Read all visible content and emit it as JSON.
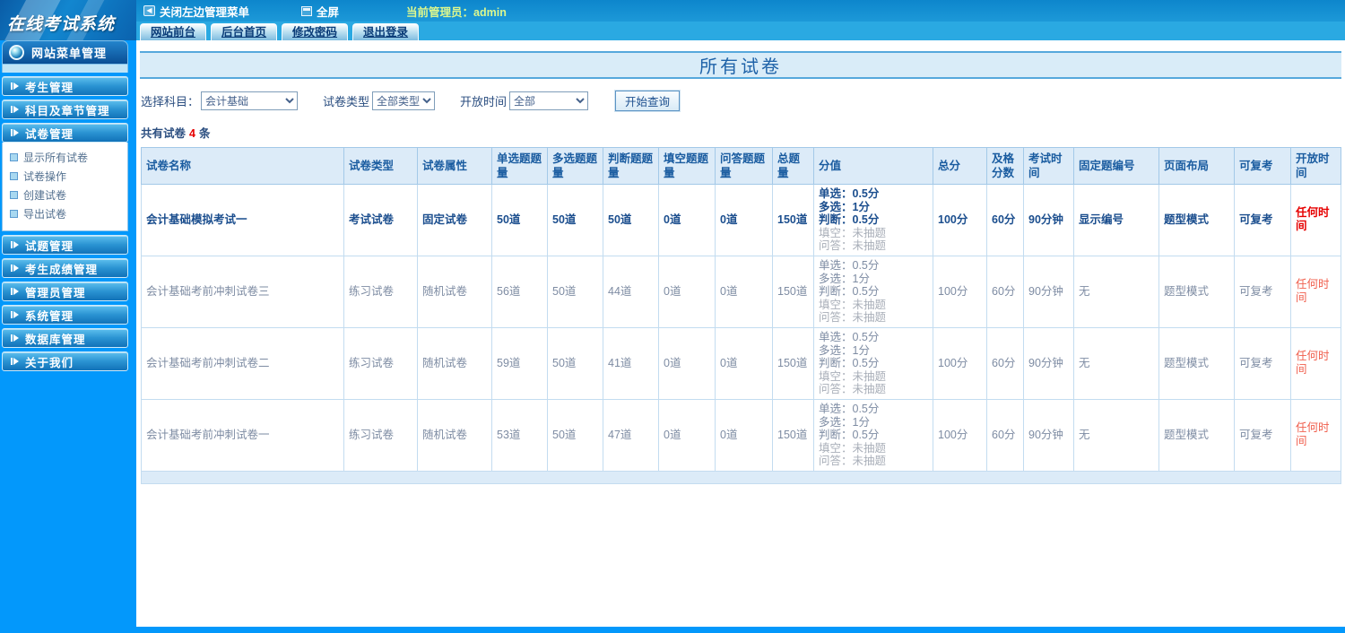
{
  "topbar": {
    "logo": "在线考试系统",
    "close_menu_label": "关闭左边管理菜单",
    "fullscreen_label": "全屏",
    "admin_label": "当前管理员：admin",
    "tabs": [
      "网站前台",
      "后台首页",
      "修改密码",
      "退出登录"
    ]
  },
  "sidebar": {
    "header": "网站菜单管理",
    "items": [
      "考生管理",
      "科目及章节管理",
      "试卷管理",
      "试题管理",
      "考生成绩管理",
      "管理员管理",
      "系统管理",
      "数据库管理",
      "关于我们"
    ],
    "submenu": [
      "显示所有试卷",
      "试卷操作",
      "创建试卷",
      "导出试卷"
    ]
  },
  "main": {
    "title": "所有试卷",
    "filters": {
      "subject_label": "选择科目：",
      "subject_value": "会计基础",
      "type_label": "试卷类型",
      "type_value": "全部类型",
      "open_label": "开放时间",
      "open_value": "全部",
      "query_button": "开始查询"
    },
    "count": {
      "prefix": "共有试卷",
      "value": "4",
      "suffix": "条"
    }
  },
  "table": {
    "columns": [
      "试卷名称",
      "试卷类型",
      "试卷属性",
      "单选题题量",
      "多选题题量",
      "判断题题量",
      "填空题题量",
      "问答题题量",
      "总题量",
      "分值",
      "总分",
      "及格分数",
      "考试时间",
      "固定题编号",
      "页面布局",
      "可复考",
      "开放时间"
    ],
    "rows": [
      {
        "name": "会计基础模拟考试一",
        "type": "考试试卷",
        "attr": "固定试卷",
        "single": "50道",
        "multi": "50道",
        "judge": "50道",
        "blank": "0道",
        "qa": "0道",
        "total": "150道",
        "scores": [
          "单选：0.5分",
          "多选：1分",
          "判断：0.5分",
          "填空：未抽题",
          "问答：未抽题"
        ],
        "total_score": "100分",
        "pass_score": "60分",
        "exam_time": "90分钟",
        "fixed_no": "显示编号",
        "layout": "题型模式",
        "retake": "可复考",
        "open_time": "任何时间"
      },
      {
        "name": "会计基础考前冲刺试卷三",
        "type": "练习试卷",
        "attr": "随机试卷",
        "single": "56道",
        "multi": "50道",
        "judge": "44道",
        "blank": "0道",
        "qa": "0道",
        "total": "150道",
        "scores": [
          "单选：0.5分",
          "多选：1分",
          "判断：0.5分",
          "填空：未抽题",
          "问答：未抽题"
        ],
        "total_score": "100分",
        "pass_score": "60分",
        "exam_time": "90分钟",
        "fixed_no": "无",
        "layout": "题型模式",
        "retake": "可复考",
        "open_time": "任何时间"
      },
      {
        "name": "会计基础考前冲刺试卷二",
        "type": "练习试卷",
        "attr": "随机试卷",
        "single": "59道",
        "multi": "50道",
        "judge": "41道",
        "blank": "0道",
        "qa": "0道",
        "total": "150道",
        "scores": [
          "单选：0.5分",
          "多选：1分",
          "判断：0.5分",
          "填空：未抽题",
          "问答：未抽题"
        ],
        "total_score": "100分",
        "pass_score": "60分",
        "exam_time": "90分钟",
        "fixed_no": "无",
        "layout": "题型模式",
        "retake": "可复考",
        "open_time": "任何时间"
      },
      {
        "name": "会计基础考前冲刺试卷一",
        "type": "练习试卷",
        "attr": "随机试卷",
        "single": "53道",
        "multi": "50道",
        "judge": "47道",
        "blank": "0道",
        "qa": "0道",
        "total": "150道",
        "scores": [
          "单选：0.5分",
          "多选：1分",
          "判断：0.5分",
          "填空：未抽题",
          "问答：未抽题"
        ],
        "total_score": "100分",
        "pass_score": "60分",
        "exam_time": "90分钟",
        "fixed_no": "无",
        "layout": "题型模式",
        "retake": "可复考",
        "open_time": "任何时间"
      }
    ]
  },
  "colors": {
    "sidebar_blue": "#0398fb",
    "header_gradient_top": "#0d86cc",
    "table_header_bg": "#dcebf8",
    "accent_navy": "#1a5ca0",
    "alert_red": "#e60000",
    "admin_text": "#dcf78e"
  }
}
